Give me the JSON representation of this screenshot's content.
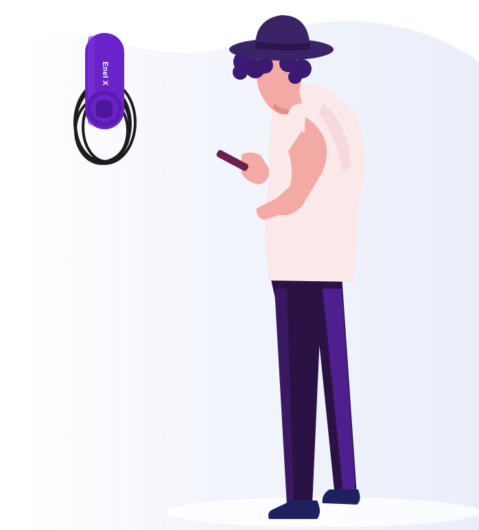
{
  "charger": {
    "brand_label": "Enel X"
  },
  "colors": {
    "accent": "#6a22c9",
    "accent_dark": "#4e169b",
    "cable": "#1c1c1c",
    "hat": "#3b2466",
    "hair": "#3b1a74",
    "skin": "#f3a9a4",
    "shirt": "#fbe9ea",
    "pants": "#2b1244",
    "pants_shade": "#4e1f8e",
    "shoes": "#1f2060",
    "phone": "#6b1f4f",
    "background_wash": "#eef1fa"
  }
}
